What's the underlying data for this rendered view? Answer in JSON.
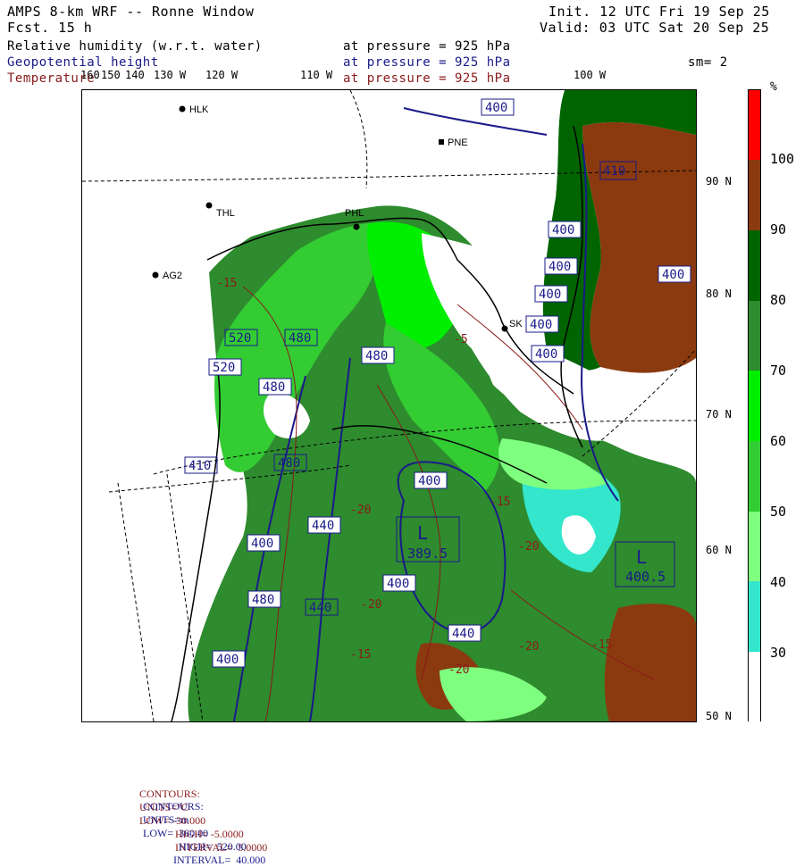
{
  "header": {
    "title": "AMPS 8-km WRF -- Ronne Window",
    "forecast": "Fcst.   15 h",
    "init": "Init. 12 UTC Fri 19 Sep 25",
    "valid": "Valid: 03 UTC Sat 20 Sep 25",
    "sm": "sm= 2",
    "fields": [
      {
        "name": "Relative humidity (w.r.t. water)",
        "level": "at pressure =  925 hPa",
        "color": "#000000"
      },
      {
        "name": "Geopotential height",
        "level": "at pressure =  925 hPa",
        "color": "#1a1a8a"
      },
      {
        "name": "Temperature",
        "level": "at pressure =  925 hPa",
        "color": "#8a1a1a"
      }
    ]
  },
  "longitude_labels": [
    "160",
    "150",
    "140",
    "130 W",
    "120 W",
    "110 W",
    "100 W"
  ],
  "latitude_labels": [
    "90 N",
    "80 N",
    "70 N",
    "60 N",
    "50 N"
  ],
  "stations": [
    "HLK",
    "PNE",
    "THL",
    "PHL",
    "AG2",
    "SK"
  ],
  "contour_labels_height": [
    "400",
    "410",
    "400",
    "400",
    "400",
    "400",
    "400",
    "400",
    "520",
    "520",
    "480",
    "480",
    "480",
    "440",
    "400",
    "400",
    "410",
    "480",
    "440",
    "440",
    "400",
    "400",
    "480",
    "480",
    "480"
  ],
  "contour_labels_temp": [
    "-15",
    "-5",
    "-20",
    "-15",
    "-20",
    "-20",
    "-20",
    "-15",
    "-15",
    "-20"
  ],
  "pressure_centers": [
    {
      "type": "L",
      "value": "389.5"
    },
    {
      "type": "L",
      "value": "400.5"
    }
  ],
  "colorbar": {
    "unit": "%",
    "levels": [
      "100",
      "90",
      "80",
      "70",
      "60",
      "50",
      "40",
      "30"
    ],
    "colors": [
      "#ff0000",
      "#8b3a0f",
      "#006400",
      "#2e8b2e",
      "#00ee00",
      "#33cc33",
      "#7fff7f",
      "#33e6cc",
      "#ffffff"
    ]
  },
  "footer": {
    "temp": {
      "label": "CONTOURS:",
      "units": "UNITS=°C",
      "low": "LOW= -30.000",
      "high": "HIGH= -5.0000",
      "interval": "INTERVAL=  5.0000",
      "color": "#8a1a1a"
    },
    "height": {
      "label": "CONTOURS:",
      "units": "UNITS=m",
      "low": "LOW=  360.00",
      "high": "HIGH=  520.00",
      "interval": "INTERVAL=  40.000",
      "color": "#1a1a8a"
    }
  }
}
